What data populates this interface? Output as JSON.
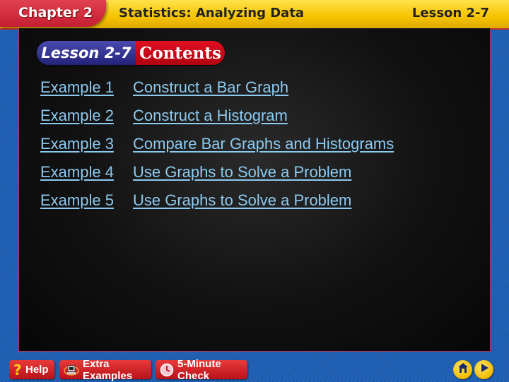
{
  "header": {
    "chapter": "Chapter 2",
    "title": "Statistics: Analyzing Data",
    "lesson": "Lesson 2-7"
  },
  "badge": {
    "lesson": "Lesson 2-7",
    "contents": "Contents"
  },
  "examples": [
    {
      "number": "Example 1",
      "title": "Construct a Bar Graph"
    },
    {
      "number": "Example 2",
      "title": "Construct a Histogram"
    },
    {
      "number": "Example 3",
      "title": "Compare Bar Graphs and Histograms"
    },
    {
      "number": "Example 4",
      "title": "Use Graphs to Solve a Problem"
    },
    {
      "number": "Example 5",
      "title": "Use Graphs to Solve a Problem"
    }
  ],
  "footer": {
    "help": "Help",
    "extra_examples": "Extra Examples",
    "five_minute_check": "5-Minute Check",
    "home_icon": "home-icon",
    "next_icon": "play-next-icon"
  },
  "colors": {
    "header_yellow": "#f6c300",
    "chapter_red": "#c41e32",
    "link_blue": "#8ccaf0",
    "background_blue": "#1b5fb5"
  }
}
